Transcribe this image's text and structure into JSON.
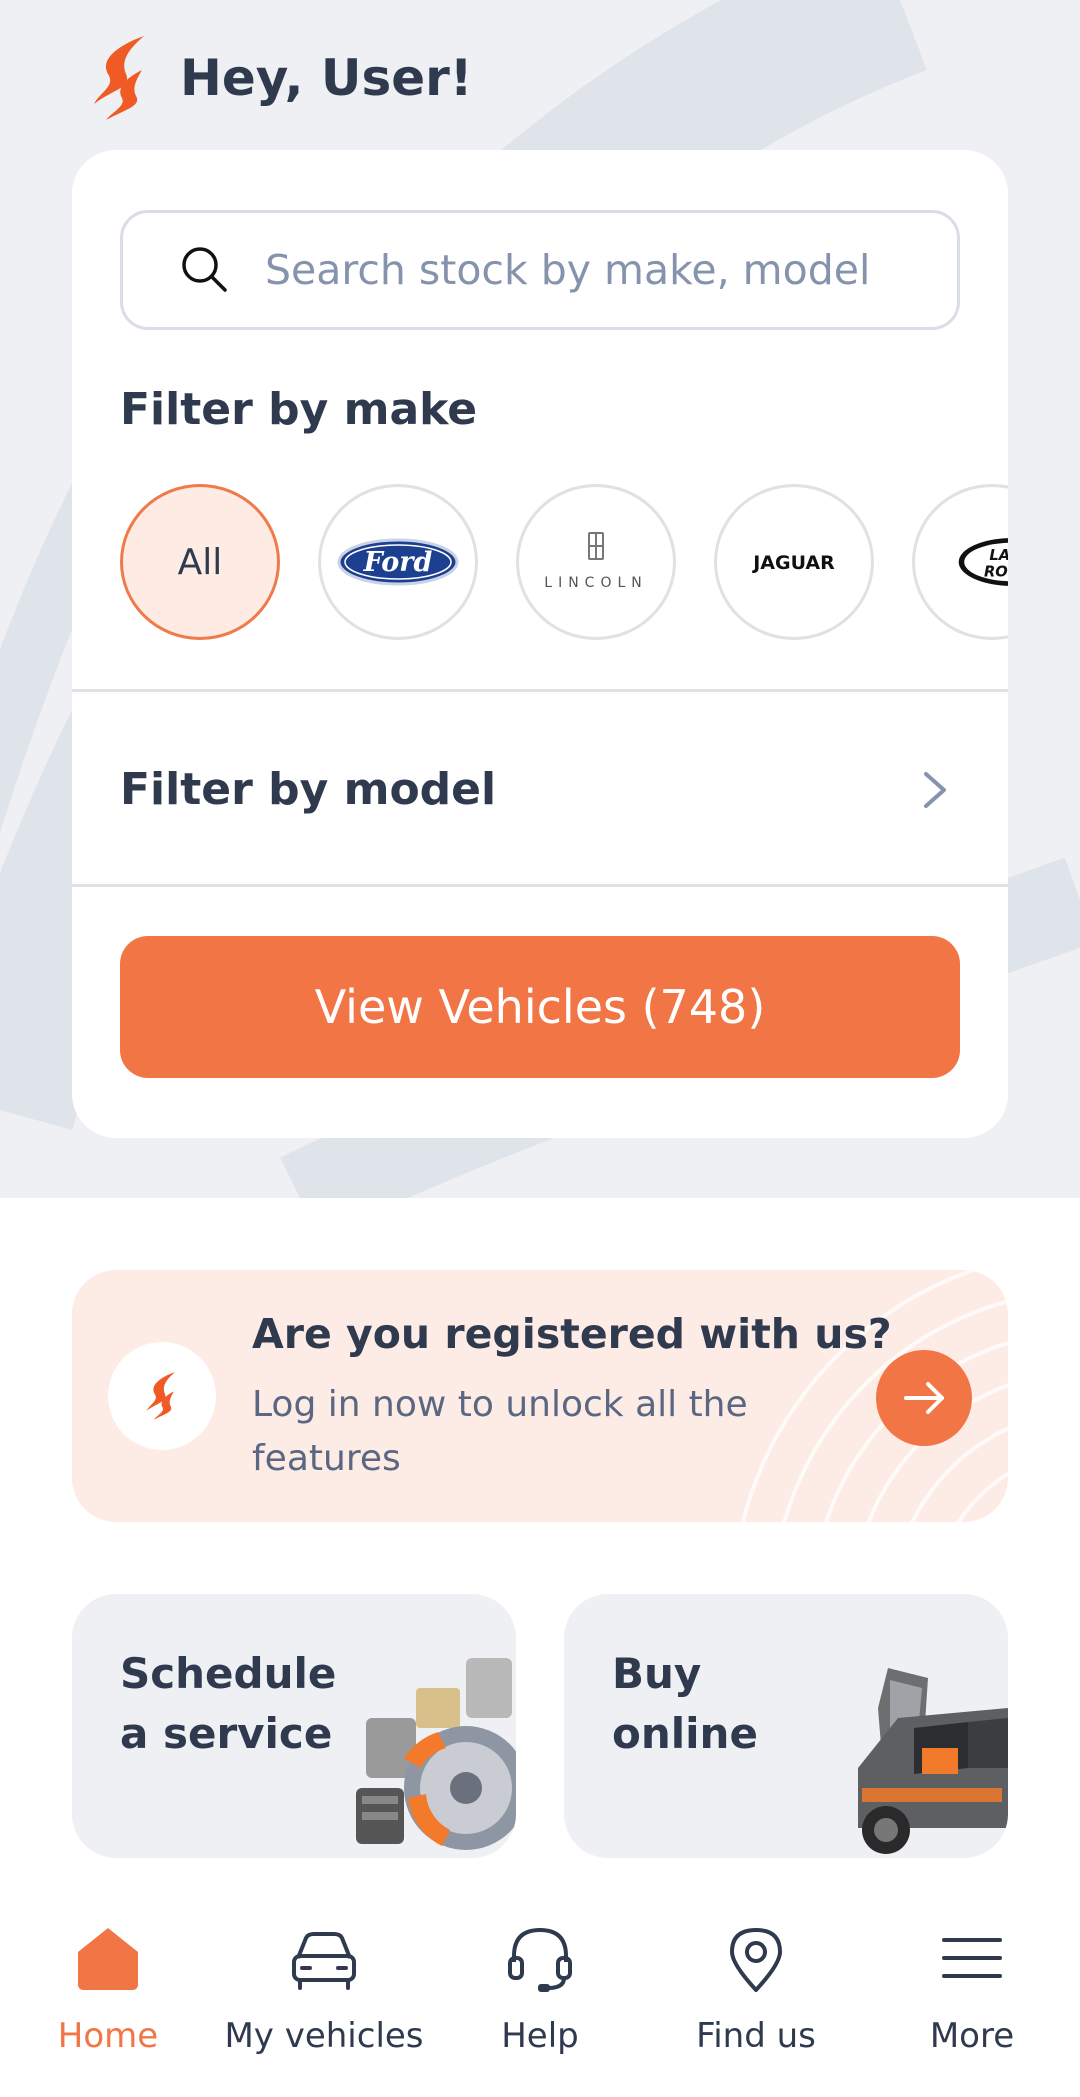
{
  "header": {
    "greeting": "Hey, User!"
  },
  "search": {
    "placeholder": "Search stock by make, model"
  },
  "filter_make": {
    "title": "Filter by make",
    "makes": [
      {
        "label": "All",
        "selected": true
      },
      {
        "label": "Ford",
        "logo": "ford-logo"
      },
      {
        "label": "LINCOLN",
        "logo": "lincoln-logo"
      },
      {
        "label": "JAGUAR",
        "logo": "jaguar-logo"
      },
      {
        "label": "LAND ROVER",
        "logo": "land-rover-logo"
      }
    ]
  },
  "filter_model": {
    "title": "Filter by model"
  },
  "cta": {
    "label": "View Vehicles (748)"
  },
  "promo": {
    "title": "Are you registered with us?",
    "subtitle": "Log in now to unlock all the features"
  },
  "tiles": [
    {
      "label": "Schedule a service",
      "art": "car-parts-illustration"
    },
    {
      "label": "Buy online",
      "art": "suv-illustration"
    }
  ],
  "nav": [
    {
      "label": "Home",
      "icon": "home-icon",
      "active": true
    },
    {
      "label": "My vehicles",
      "icon": "car-icon",
      "active": false
    },
    {
      "label": "Help",
      "icon": "headset-icon",
      "active": false
    },
    {
      "label": "Find us",
      "icon": "map-pin-icon",
      "active": false
    },
    {
      "label": "More",
      "icon": "menu-icon",
      "active": false
    }
  ],
  "colors": {
    "accent": "#f27546",
    "text": "#2f3a4e",
    "muted": "#8593ad",
    "promo_bg": "#fdebe5",
    "hero_bg": "#eff0f3"
  }
}
